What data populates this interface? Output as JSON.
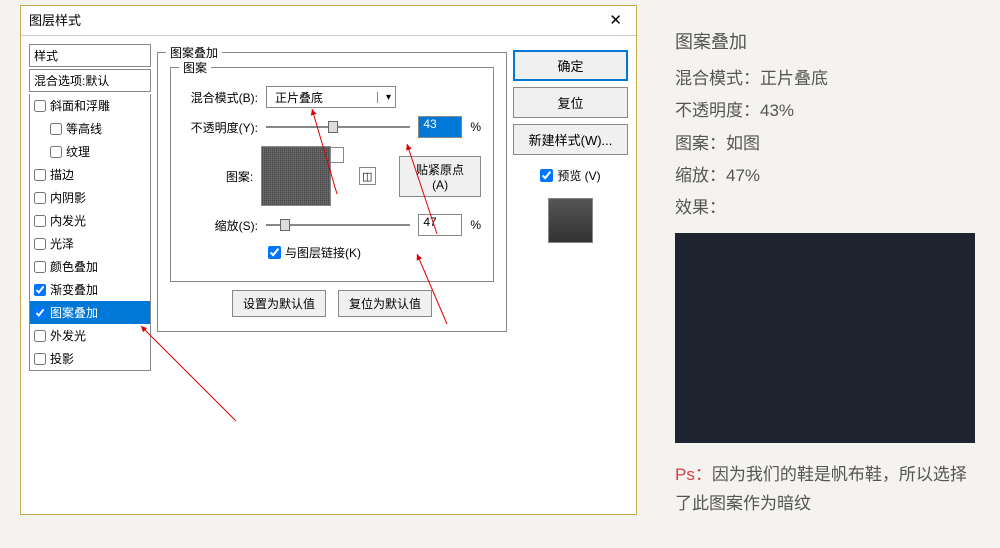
{
  "dialog": {
    "title": "图层样式",
    "close": "✕",
    "styles_header": "样式",
    "blend_header": "混合选项:默认",
    "items": [
      {
        "label": "斜面和浮雕",
        "checked": false,
        "indent": false
      },
      {
        "label": "等高线",
        "checked": false,
        "indent": true
      },
      {
        "label": "纹理",
        "checked": false,
        "indent": true
      },
      {
        "label": "描边",
        "checked": false,
        "indent": false
      },
      {
        "label": "内阴影",
        "checked": false,
        "indent": false
      },
      {
        "label": "内发光",
        "checked": false,
        "indent": false
      },
      {
        "label": "光泽",
        "checked": false,
        "indent": false
      },
      {
        "label": "颜色叠加",
        "checked": false,
        "indent": false
      },
      {
        "label": "渐变叠加",
        "checked": true,
        "indent": false
      },
      {
        "label": "图案叠加",
        "checked": true,
        "indent": false,
        "selected": true
      },
      {
        "label": "外发光",
        "checked": false,
        "indent": false
      },
      {
        "label": "投影",
        "checked": false,
        "indent": false
      }
    ]
  },
  "overlay": {
    "group_title": "图案叠加",
    "inner_title": "图案",
    "blend_label": "混合模式(B):",
    "blend_value": "正片叠底",
    "opacity_label": "不透明度(Y):",
    "opacity_value": "43",
    "pattern_label": "图案:",
    "snap_btn": "贴紧原点(A)",
    "scale_label": "缩放(S):",
    "scale_value": "47",
    "link_label": "与图层链接(K)",
    "set_default": "设置为默认值",
    "reset_default": "复位为默认值",
    "percent": "%"
  },
  "right": {
    "ok": "确定",
    "reset": "复位",
    "new_style": "新建样式(W)...",
    "preview": "预览 (V)"
  },
  "annot": {
    "title": "图案叠加",
    "l1": "混合模式：正片叠底",
    "l2": "不透明度：43%",
    "l3": "图案：如图",
    "l4": "缩放：47%",
    "l5": "效果：",
    "ps_label": "Ps：",
    "ps_text": "因为我们的鞋是帆布鞋，所以选择了此图案作为暗纹"
  }
}
